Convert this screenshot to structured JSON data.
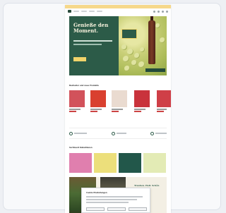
{
  "topbar": {
    "text": ""
  },
  "hero": {
    "title": "Genieße den Moment.",
    "button_label": "",
    "badge_text": "",
    "secondary_cta": ""
  },
  "sections": {
    "products_title": "Bestseller und neue Produkte",
    "collections_title": "Sortiment Kollektionen"
  },
  "story": {
    "title": "Trauben. Hell. Schön Besser."
  },
  "cookie": {
    "title": "Cookie Einstellungen",
    "buttons": [
      "",
      "",
      ""
    ]
  },
  "colors": {
    "brand_green": "#2c5b48",
    "accent_yellow": "#f1d36a",
    "topbar_yellow": "#f6d88a"
  }
}
